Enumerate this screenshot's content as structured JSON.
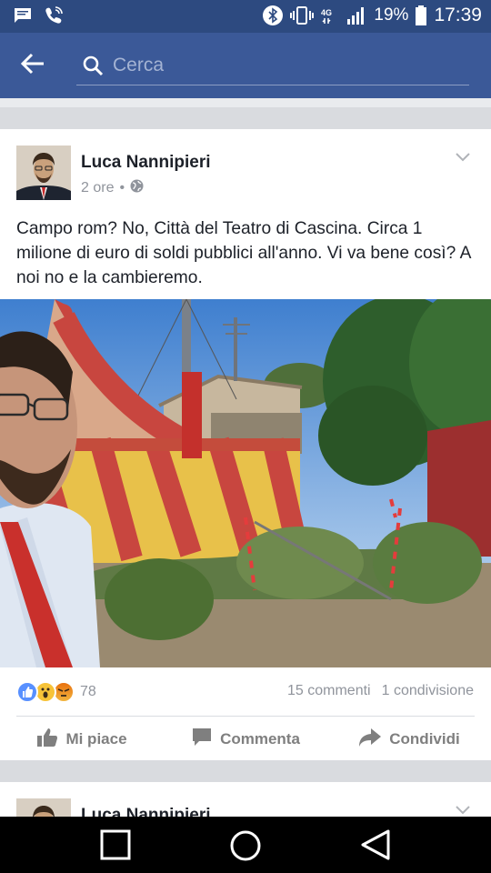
{
  "status_bar": {
    "battery_percent": "19%",
    "time": "17:39",
    "icons": [
      "message-icon",
      "phone-wifi-icon",
      "bluetooth-icon",
      "vibrate-icon",
      "4g-icon",
      "signal-icon",
      "battery-icon"
    ]
  },
  "search": {
    "placeholder": "Cerca"
  },
  "post": {
    "author": "Luca Nannipieri",
    "time": "2 ore",
    "separator": "•",
    "privacy_icon": "globe-icon",
    "text": "Campo rom? No, Città del Teatro di Cascina. Circa 1 milione di euro di soldi pubblici all'anno. Vi va bene così? A noi no e la cambieremo.",
    "reactions": {
      "types": [
        "like",
        "wow",
        "angry"
      ],
      "count": "78"
    },
    "comments": "15 commenti",
    "shares": "1 condivisione",
    "actions": {
      "like": "Mi piace",
      "comment": "Commenta",
      "share": "Condividi"
    }
  },
  "next_post": {
    "author": "Luca Nannipieri"
  },
  "colors": {
    "facebook_blue": "#3b5998",
    "status_bar": "#2d4a80",
    "like_blue": "#5890ff",
    "wow_yellow": "#f7c338",
    "angry_red": "#e9710f"
  }
}
